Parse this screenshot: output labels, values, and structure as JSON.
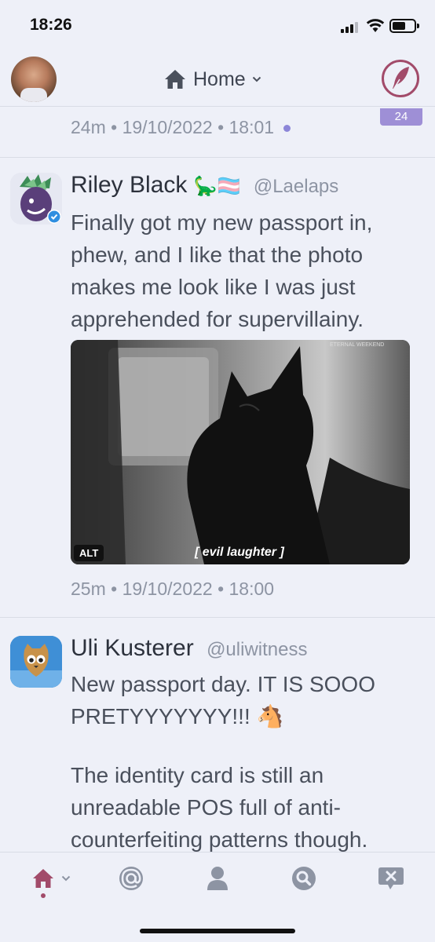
{
  "status_bar": {
    "time": "18:26"
  },
  "header": {
    "title": "Home",
    "unread_badge": "24"
  },
  "timeline": [
    {
      "meta": "24m • 19/10/2022 • 18:01"
    },
    {
      "name": "Riley Black",
      "name_emoji": "🦕🏳️‍⚧️",
      "handle": "@Laelaps",
      "verified": true,
      "text_lines": [
        "Finally got my new passport in,",
        "phew, and I like that the photo",
        "makes me look like I was just",
        "apprehended for supervillainy."
      ],
      "media": {
        "alt_label": "ALT",
        "caption": "[ evil laughter ]",
        "watermark": "ETERNAL WEEKEND"
      },
      "meta": "25m • 19/10/2022 • 18:00"
    },
    {
      "name": "Uli Kusterer",
      "handle": "@uliwitness",
      "text_lines": [
        "New passport day. IT IS SOOO",
        "PRETYYYYYYY!!! 🐴",
        "",
        "The identity card is still an",
        "unreadable POS full of anti-",
        "counterfeiting patterns though."
      ]
    }
  ],
  "colors": {
    "background": "#eef0f8",
    "accent": "#a24b6a",
    "badge": "#9e8fd6",
    "unread_dot": "#8c86d8",
    "secondary_text": "#8d94a3"
  },
  "tab_bar": [
    {
      "icon": "home-icon"
    },
    {
      "icon": "at-mention-icon"
    },
    {
      "icon": "profile-icon"
    },
    {
      "icon": "search-icon"
    },
    {
      "icon": "messages-icon"
    }
  ]
}
